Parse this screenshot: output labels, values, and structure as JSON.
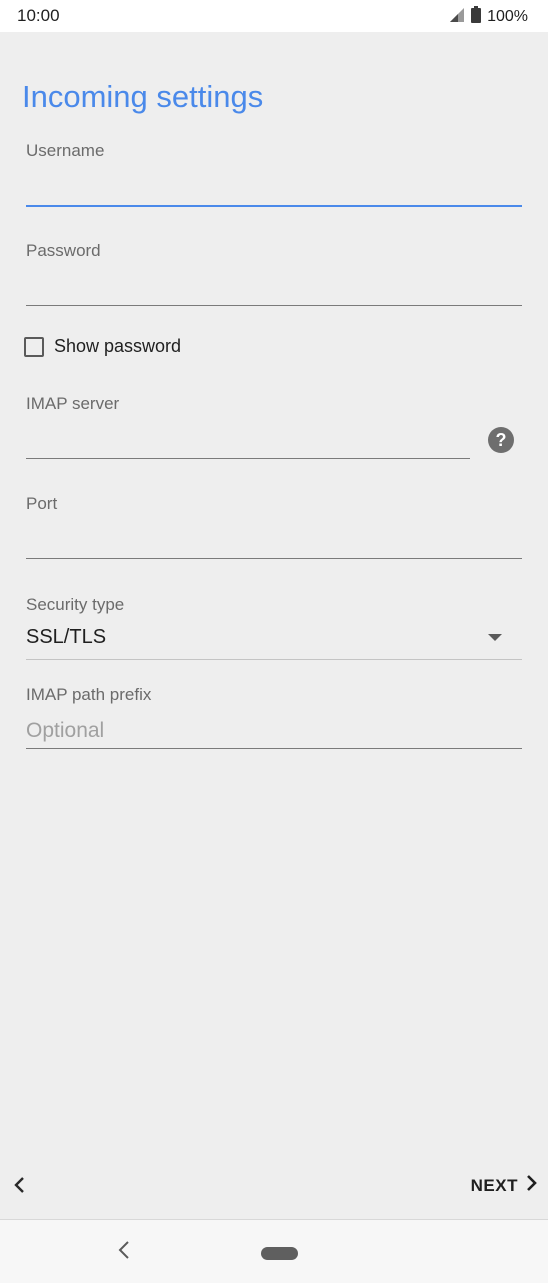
{
  "status_bar": {
    "time": "10:00",
    "battery": "100%",
    "icons": [
      "signal-icon",
      "battery-icon"
    ]
  },
  "page": {
    "title": "Incoming settings"
  },
  "fields": {
    "username": {
      "label": "Username",
      "value": ""
    },
    "password": {
      "label": "Password",
      "value": ""
    },
    "show_password": {
      "label": "Show password",
      "checked": false
    },
    "imap_server": {
      "label": "IMAP server",
      "value": ""
    },
    "port": {
      "label": "Port",
      "value": ""
    },
    "security_type": {
      "label": "Security type",
      "value": "SSL/TLS"
    },
    "imap_path_prefix": {
      "label": "IMAP path prefix",
      "value": "",
      "placeholder": "Optional"
    }
  },
  "bottom_actions": {
    "next_label": "NEXT",
    "icons": [
      "chevron-left-icon",
      "chevron-right-icon"
    ]
  },
  "navigation_bar": {
    "icons": [
      "nav-back-icon",
      "nav-home-pill"
    ]
  },
  "colors": {
    "accent": "#4a89ea",
    "background": "#eeeeee",
    "text": "#1f1f1f",
    "label": "#6b6b6b"
  }
}
